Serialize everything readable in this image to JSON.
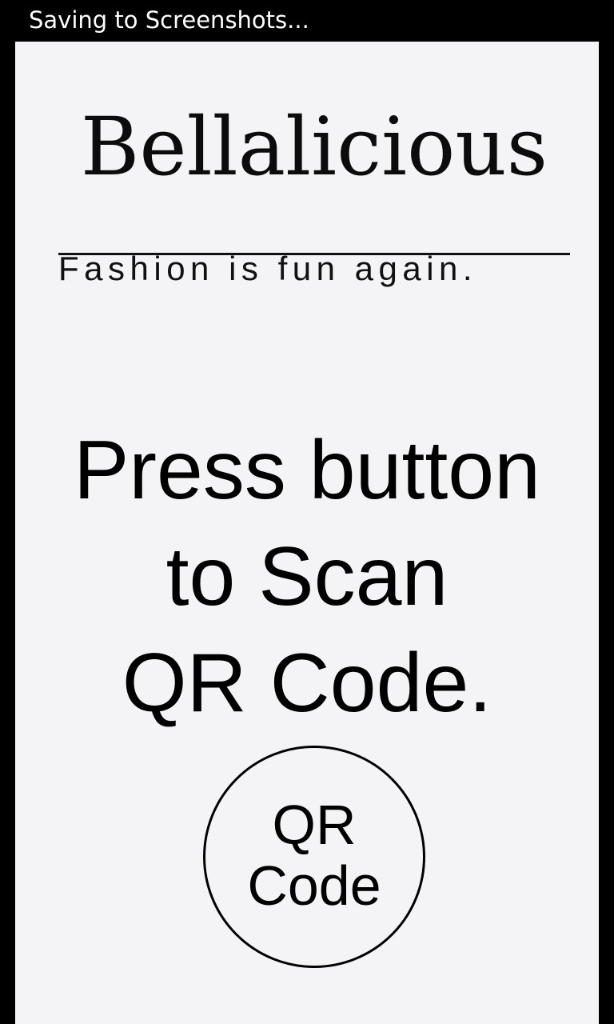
{
  "status_bar": {
    "text": "Saving to Screenshots..."
  },
  "logo": {
    "name": "Bellalicious",
    "tagline": "Fashion is fun again."
  },
  "instruction": {
    "line1": "Press button",
    "line2": "to Scan",
    "line3": "QR Code."
  },
  "qr_button": {
    "line1": "QR",
    "line2": "Code"
  },
  "colors": {
    "background": "#f4f4f6",
    "frame": "#000000",
    "text": "#000000"
  }
}
